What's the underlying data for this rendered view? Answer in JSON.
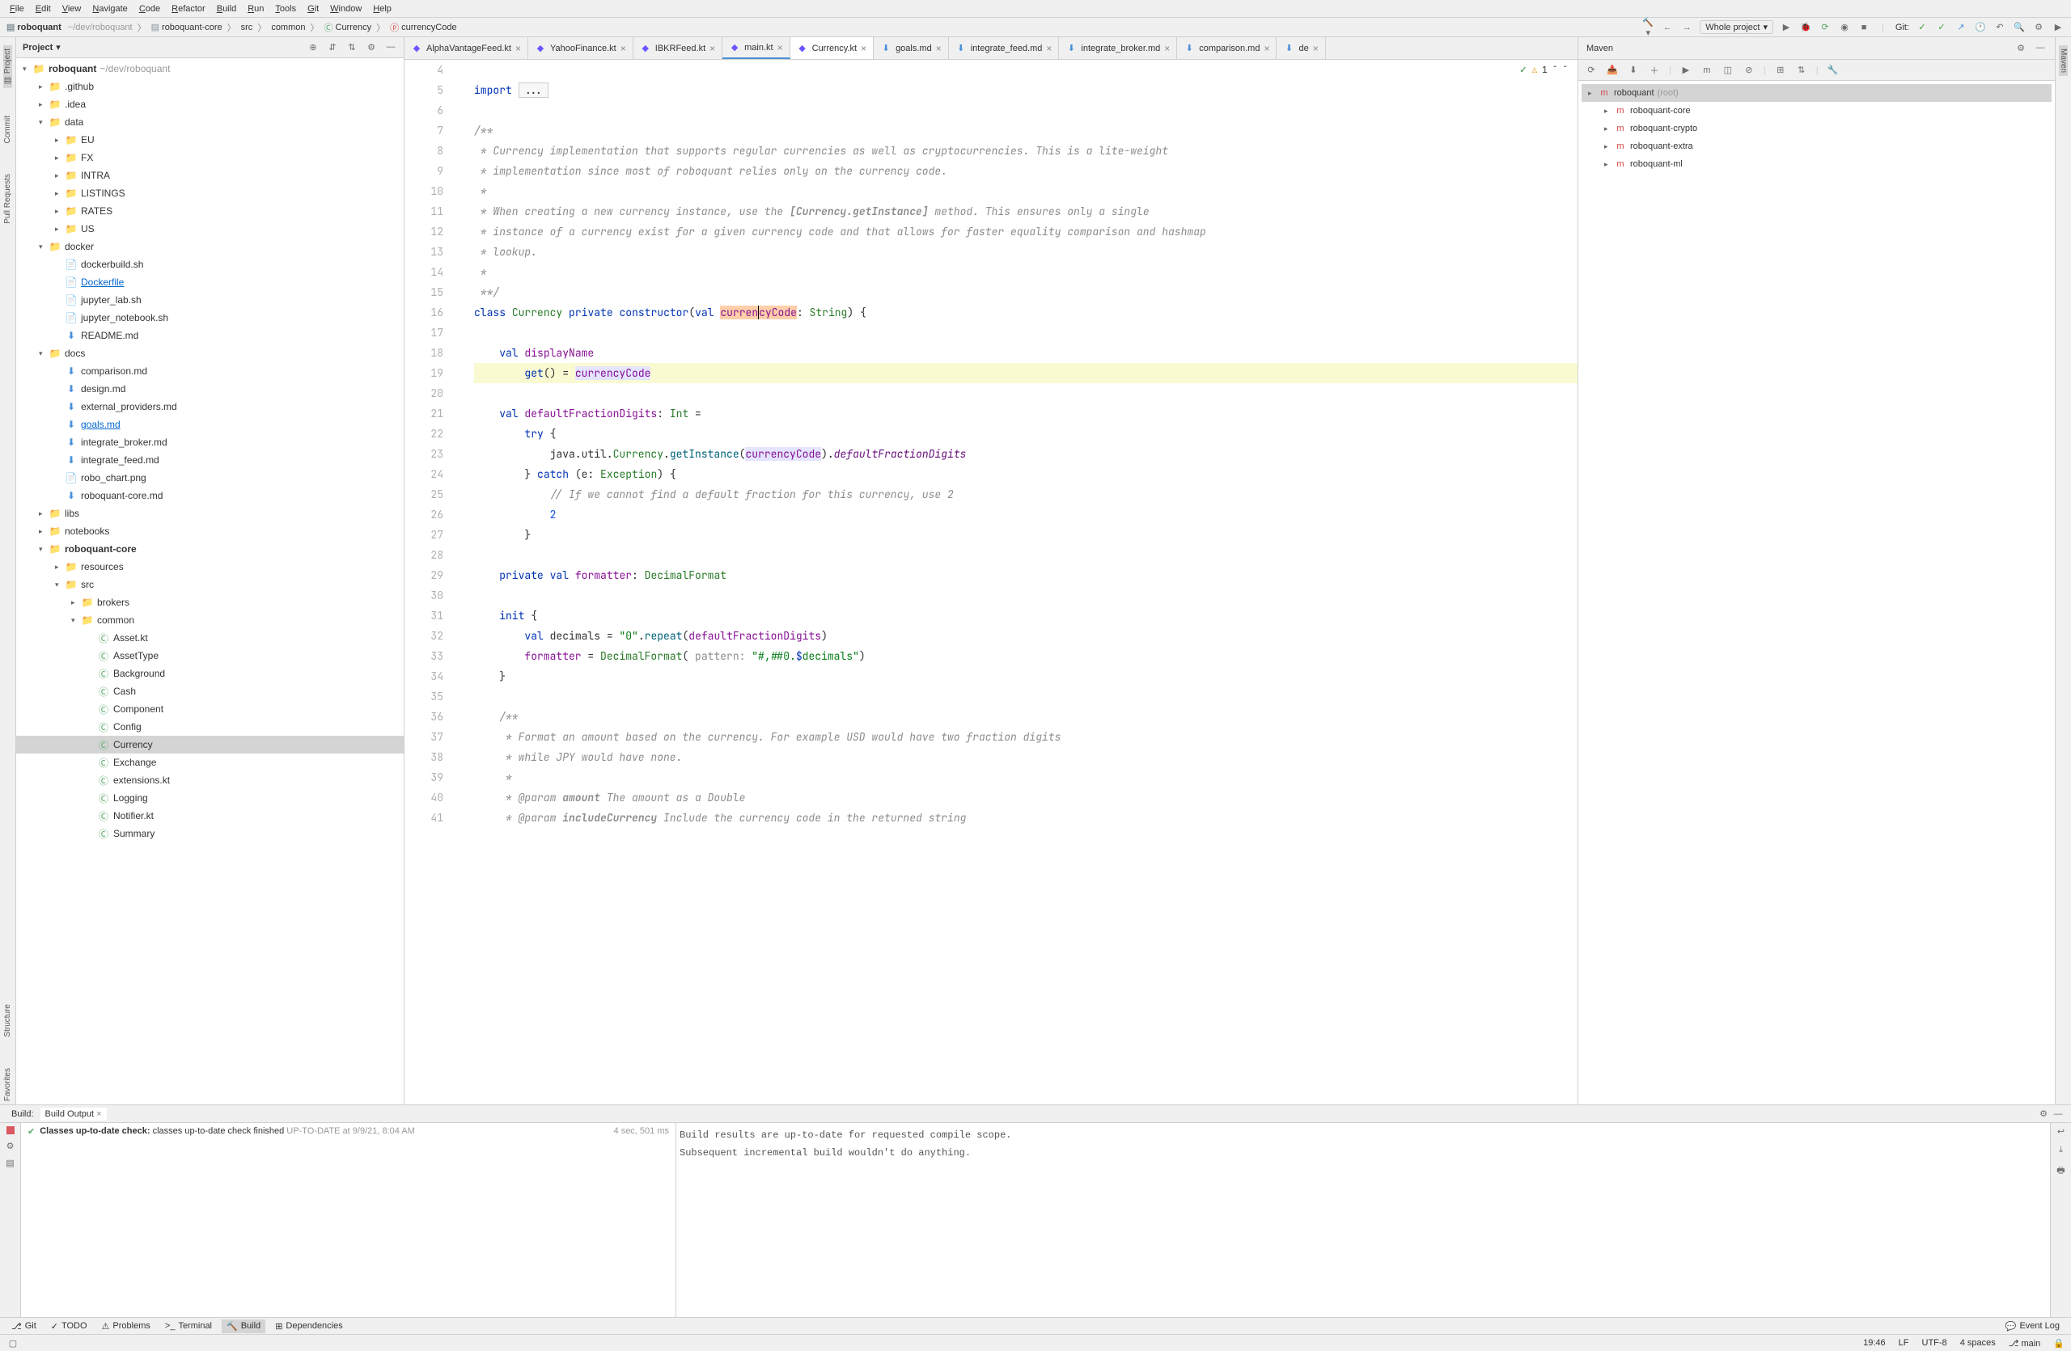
{
  "menu": [
    "File",
    "Edit",
    "View",
    "Navigate",
    "Code",
    "Refactor",
    "Build",
    "Run",
    "Tools",
    "Git",
    "Window",
    "Help"
  ],
  "breadcrumb": {
    "project": "roboquant",
    "path_hint": "~/dev/roboquant",
    "module": "roboquant-core",
    "src": "src",
    "pkg": "common",
    "file": "Currency",
    "member": "currencyCode"
  },
  "scope": "Whole project",
  "git_label": "Git:",
  "project_panel": {
    "title": "Project"
  },
  "tree": [
    {
      "depth": 0,
      "arrow": "▾",
      "icon": "folder",
      "label": "roboquant",
      "hint": "~/dev/roboquant",
      "bold": true
    },
    {
      "depth": 1,
      "arrow": "▸",
      "icon": "folder",
      "label": ".github"
    },
    {
      "depth": 1,
      "arrow": "▸",
      "icon": "folder",
      "label": ".idea"
    },
    {
      "depth": 1,
      "arrow": "▾",
      "icon": "folder",
      "label": "data"
    },
    {
      "depth": 2,
      "arrow": "▸",
      "icon": "folder",
      "label": "EU"
    },
    {
      "depth": 2,
      "arrow": "▸",
      "icon": "folder",
      "label": "FX"
    },
    {
      "depth": 2,
      "arrow": "▸",
      "icon": "folder",
      "label": "INTRA"
    },
    {
      "depth": 2,
      "arrow": "▸",
      "icon": "folder",
      "label": "LISTINGS"
    },
    {
      "depth": 2,
      "arrow": "▸",
      "icon": "folder",
      "label": "RATES"
    },
    {
      "depth": 2,
      "arrow": "▸",
      "icon": "folder",
      "label": "US"
    },
    {
      "depth": 1,
      "arrow": "▾",
      "icon": "folder",
      "label": "docker"
    },
    {
      "depth": 2,
      "arrow": "",
      "icon": "file",
      "label": "dockerbuild.sh"
    },
    {
      "depth": 2,
      "arrow": "",
      "icon": "file",
      "label": "Dockerfile",
      "link": true
    },
    {
      "depth": 2,
      "arrow": "",
      "icon": "file",
      "label": "jupyter_lab.sh"
    },
    {
      "depth": 2,
      "arrow": "",
      "icon": "file",
      "label": "jupyter_notebook.sh"
    },
    {
      "depth": 2,
      "arrow": "",
      "icon": "md",
      "label": "README.md"
    },
    {
      "depth": 1,
      "arrow": "▾",
      "icon": "folder",
      "label": "docs"
    },
    {
      "depth": 2,
      "arrow": "",
      "icon": "md",
      "label": "comparison.md"
    },
    {
      "depth": 2,
      "arrow": "",
      "icon": "md",
      "label": "design.md"
    },
    {
      "depth": 2,
      "arrow": "",
      "icon": "md",
      "label": "external_providers.md"
    },
    {
      "depth": 2,
      "arrow": "",
      "icon": "md",
      "label": "goals.md",
      "link": true
    },
    {
      "depth": 2,
      "arrow": "",
      "icon": "md",
      "label": "integrate_broker.md"
    },
    {
      "depth": 2,
      "arrow": "",
      "icon": "md",
      "label": "integrate_feed.md"
    },
    {
      "depth": 2,
      "arrow": "",
      "icon": "file",
      "label": "robo_chart.png"
    },
    {
      "depth": 2,
      "arrow": "",
      "icon": "md",
      "label": "roboquant-core.md"
    },
    {
      "depth": 1,
      "arrow": "▸",
      "icon": "folder",
      "label": "libs"
    },
    {
      "depth": 1,
      "arrow": "▸",
      "icon": "folder",
      "label": "notebooks"
    },
    {
      "depth": 1,
      "arrow": "▾",
      "icon": "folder",
      "label": "roboquant-core",
      "bold": true
    },
    {
      "depth": 2,
      "arrow": "▸",
      "icon": "folder",
      "label": "resources"
    },
    {
      "depth": 2,
      "arrow": "▾",
      "icon": "folder",
      "label": "src"
    },
    {
      "depth": 3,
      "arrow": "▸",
      "icon": "folder",
      "label": "brokers"
    },
    {
      "depth": 3,
      "arrow": "▾",
      "icon": "folder",
      "label": "common"
    },
    {
      "depth": 4,
      "arrow": "",
      "icon": "kt",
      "label": "Asset.kt"
    },
    {
      "depth": 4,
      "arrow": "",
      "icon": "kt",
      "label": "AssetType"
    },
    {
      "depth": 4,
      "arrow": "",
      "icon": "kt",
      "label": "Background"
    },
    {
      "depth": 4,
      "arrow": "",
      "icon": "kt",
      "label": "Cash"
    },
    {
      "depth": 4,
      "arrow": "",
      "icon": "kt",
      "label": "Component"
    },
    {
      "depth": 4,
      "arrow": "",
      "icon": "kt",
      "label": "Config"
    },
    {
      "depth": 4,
      "arrow": "",
      "icon": "kt",
      "label": "Currency",
      "selected": true
    },
    {
      "depth": 4,
      "arrow": "",
      "icon": "kt",
      "label": "Exchange"
    },
    {
      "depth": 4,
      "arrow": "",
      "icon": "kt",
      "label": "extensions.kt"
    },
    {
      "depth": 4,
      "arrow": "",
      "icon": "kt",
      "label": "Logging"
    },
    {
      "depth": 4,
      "arrow": "",
      "icon": "kt",
      "label": "Notifier.kt"
    },
    {
      "depth": 4,
      "arrow": "",
      "icon": "kt",
      "label": "Summary"
    }
  ],
  "editor_tabs": [
    {
      "icon": "kt",
      "label": "AlphaVantageFeed.kt"
    },
    {
      "icon": "kt",
      "label": "YahooFinance.kt"
    },
    {
      "icon": "kt",
      "label": "IBKRFeed.kt"
    },
    {
      "icon": "kt",
      "label": "main.kt",
      "underlined": true
    },
    {
      "icon": "kt",
      "label": "Currency.kt",
      "active": true
    },
    {
      "icon": "md",
      "label": "goals.md"
    },
    {
      "icon": "md",
      "label": "integrate_feed.md"
    },
    {
      "icon": "md",
      "label": "integrate_broker.md"
    },
    {
      "icon": "md",
      "label": "comparison.md"
    },
    {
      "icon": "md",
      "label": "de"
    }
  ],
  "inspection": {
    "count": "1",
    "warn": ""
  },
  "code_start_line": 4,
  "maven": {
    "title": "Maven",
    "items": [
      {
        "depth": 0,
        "arrow": "▸",
        "label": "roboquant",
        "hint": "(root)",
        "selected": true
      },
      {
        "depth": 1,
        "arrow": "▸",
        "label": "roboquant-core"
      },
      {
        "depth": 1,
        "arrow": "▸",
        "label": "roboquant-crypto"
      },
      {
        "depth": 1,
        "arrow": "▸",
        "label": "roboquant-extra"
      },
      {
        "depth": 1,
        "arrow": "▸",
        "label": "roboquant-ml"
      }
    ]
  },
  "left_stripe": [
    "Commit",
    "Pull Requests",
    "Structure",
    "Favorites"
  ],
  "right_stripe": [
    "Maven"
  ],
  "build": {
    "tab1": "Build:",
    "tab2": "Build Output",
    "status_bold": "Classes up-to-date check:",
    "status_rest": " classes up-to-date check finished",
    "status_gray": " UP-TO-DATE at 9/9/21, 8:04 AM",
    "time": "4 sec, 501 ms",
    "output_l1": "Build results are up-to-date for requested compile scope.",
    "output_l2": "Subsequent incremental build wouldn't do anything."
  },
  "tool_buttons": [
    {
      "icon": "⎇",
      "label": "Git"
    },
    {
      "icon": "✓",
      "label": "TODO"
    },
    {
      "icon": "⚠",
      "label": "Problems"
    },
    {
      "icon": ">_",
      "label": "Terminal"
    },
    {
      "icon": "🔨",
      "label": "Build",
      "active": true
    },
    {
      "icon": "⊞",
      "label": "Dependencies"
    }
  ],
  "status": {
    "event_log": "Event Log",
    "position": "19:46",
    "sep": "LF",
    "enc": "UTF-8",
    "indent": "4 spaces",
    "branch": "main"
  }
}
